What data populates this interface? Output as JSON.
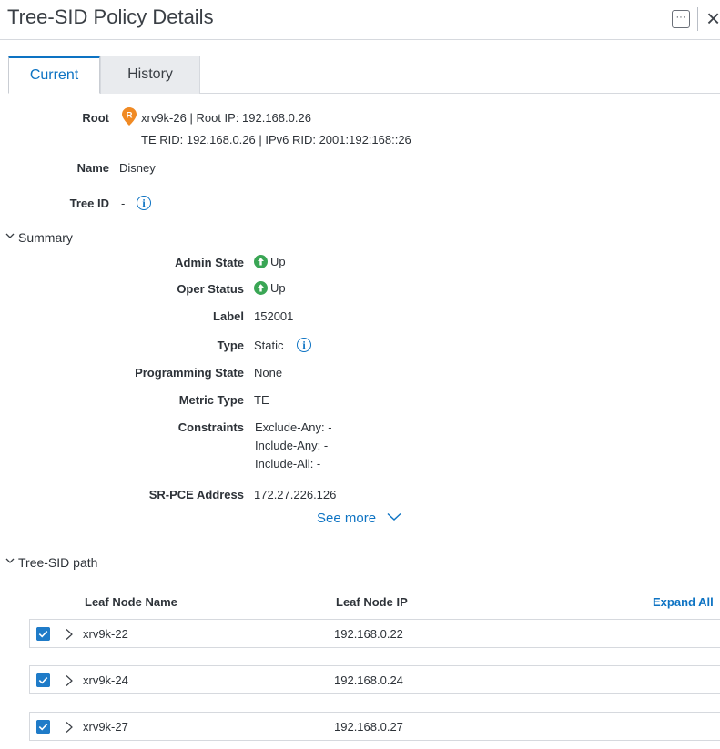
{
  "header": {
    "title": "Tree-SID Policy Details",
    "more_label": "···",
    "close_label": "×"
  },
  "tabs": [
    {
      "label": "Current",
      "active": true
    },
    {
      "label": "History",
      "active": false
    }
  ],
  "details": {
    "root_label": "Root",
    "root_badge": "R",
    "root_line1": "xrv9k-26 | Root IP: 192.168.0.26",
    "root_line2": "TE RID: 192.168.0.26 | IPv6 RID: 2001:192:168::26",
    "name_label": "Name",
    "name_value": "Disney",
    "tree_id_label": "Tree ID",
    "tree_id_value": "-"
  },
  "summary": {
    "title": "Summary",
    "admin_state_label": "Admin State",
    "admin_state_value": "Up",
    "oper_status_label": "Oper Status",
    "oper_status_value": "Up",
    "label_label": "Label",
    "label_value": "152001",
    "type_label": "Type",
    "type_value": "Static",
    "programming_state_label": "Programming State",
    "programming_state_value": "None",
    "metric_type_label": "Metric Type",
    "metric_type_value": "TE",
    "constraints_label": "Constraints",
    "constraints": [
      "Exclude-Any: -",
      "Include-Any: -",
      "Include-All: -"
    ],
    "srpce_label": "SR-PCE Address",
    "srpce_value": "172.27.226.126",
    "see_more": "See more"
  },
  "tree_sid_path": {
    "title": "Tree-SID path",
    "columns": [
      "Leaf Node Name",
      "Leaf Node IP"
    ],
    "expand_all": "Expand All",
    "rows": [
      {
        "name": "xrv9k-22",
        "ip": "192.168.0.22",
        "checked": true
      },
      {
        "name": "xrv9k-24",
        "ip": "192.168.0.24",
        "checked": true
      },
      {
        "name": "xrv9k-27",
        "ip": "192.168.0.27",
        "checked": true
      }
    ]
  },
  "icons": {
    "root_badge": "map-pin-badge-icon",
    "info": "info-icon",
    "status_up": "arrow-up-circle-icon",
    "chevron_down": "chevron-down-icon",
    "chevron_right": "chevron-right-icon",
    "checkbox": "checkbox-checked-icon"
  },
  "colors": {
    "accent": "#0d73c3",
    "root_badge": "#f08a24",
    "status_up": "#3aa655",
    "checkbox": "#1f7bc8"
  }
}
